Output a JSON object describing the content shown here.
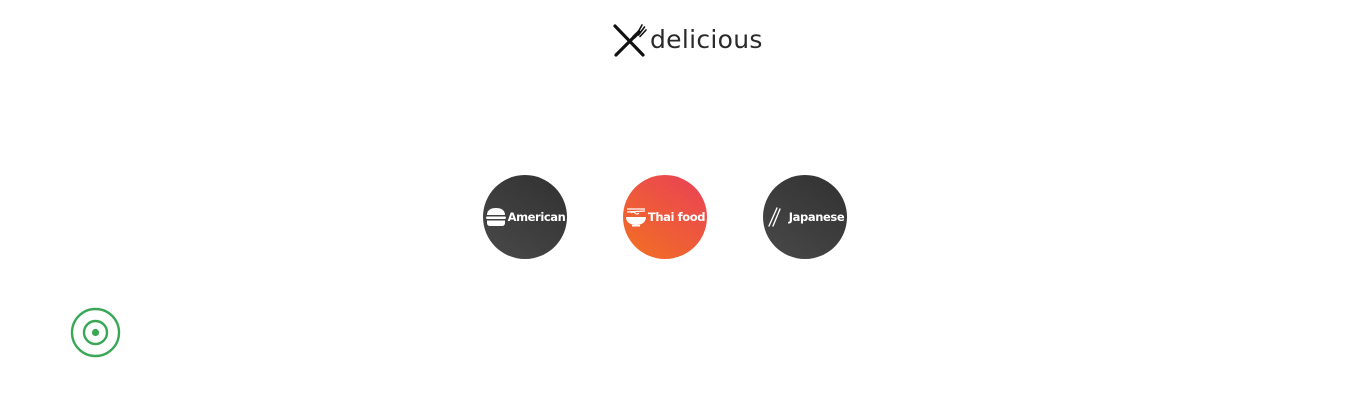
{
  "header": {
    "logo_text": "delicious",
    "logo_icon": "fork-knife-icon"
  },
  "categories": [
    {
      "label": "American",
      "icon": "burger-icon",
      "active": false
    },
    {
      "label": "Thai food",
      "icon": "noodle-bowl-icon",
      "active": true
    },
    {
      "label": "Japanese",
      "icon": "chopsticks-icon",
      "active": false
    }
  ],
  "floating_button": {
    "icon": "target-icon",
    "color": "#3aa757"
  },
  "colors": {
    "inactive_gradient": [
      "#494949",
      "#313131"
    ],
    "active_gradient": [
      "#f27121",
      "#e94057"
    ]
  }
}
